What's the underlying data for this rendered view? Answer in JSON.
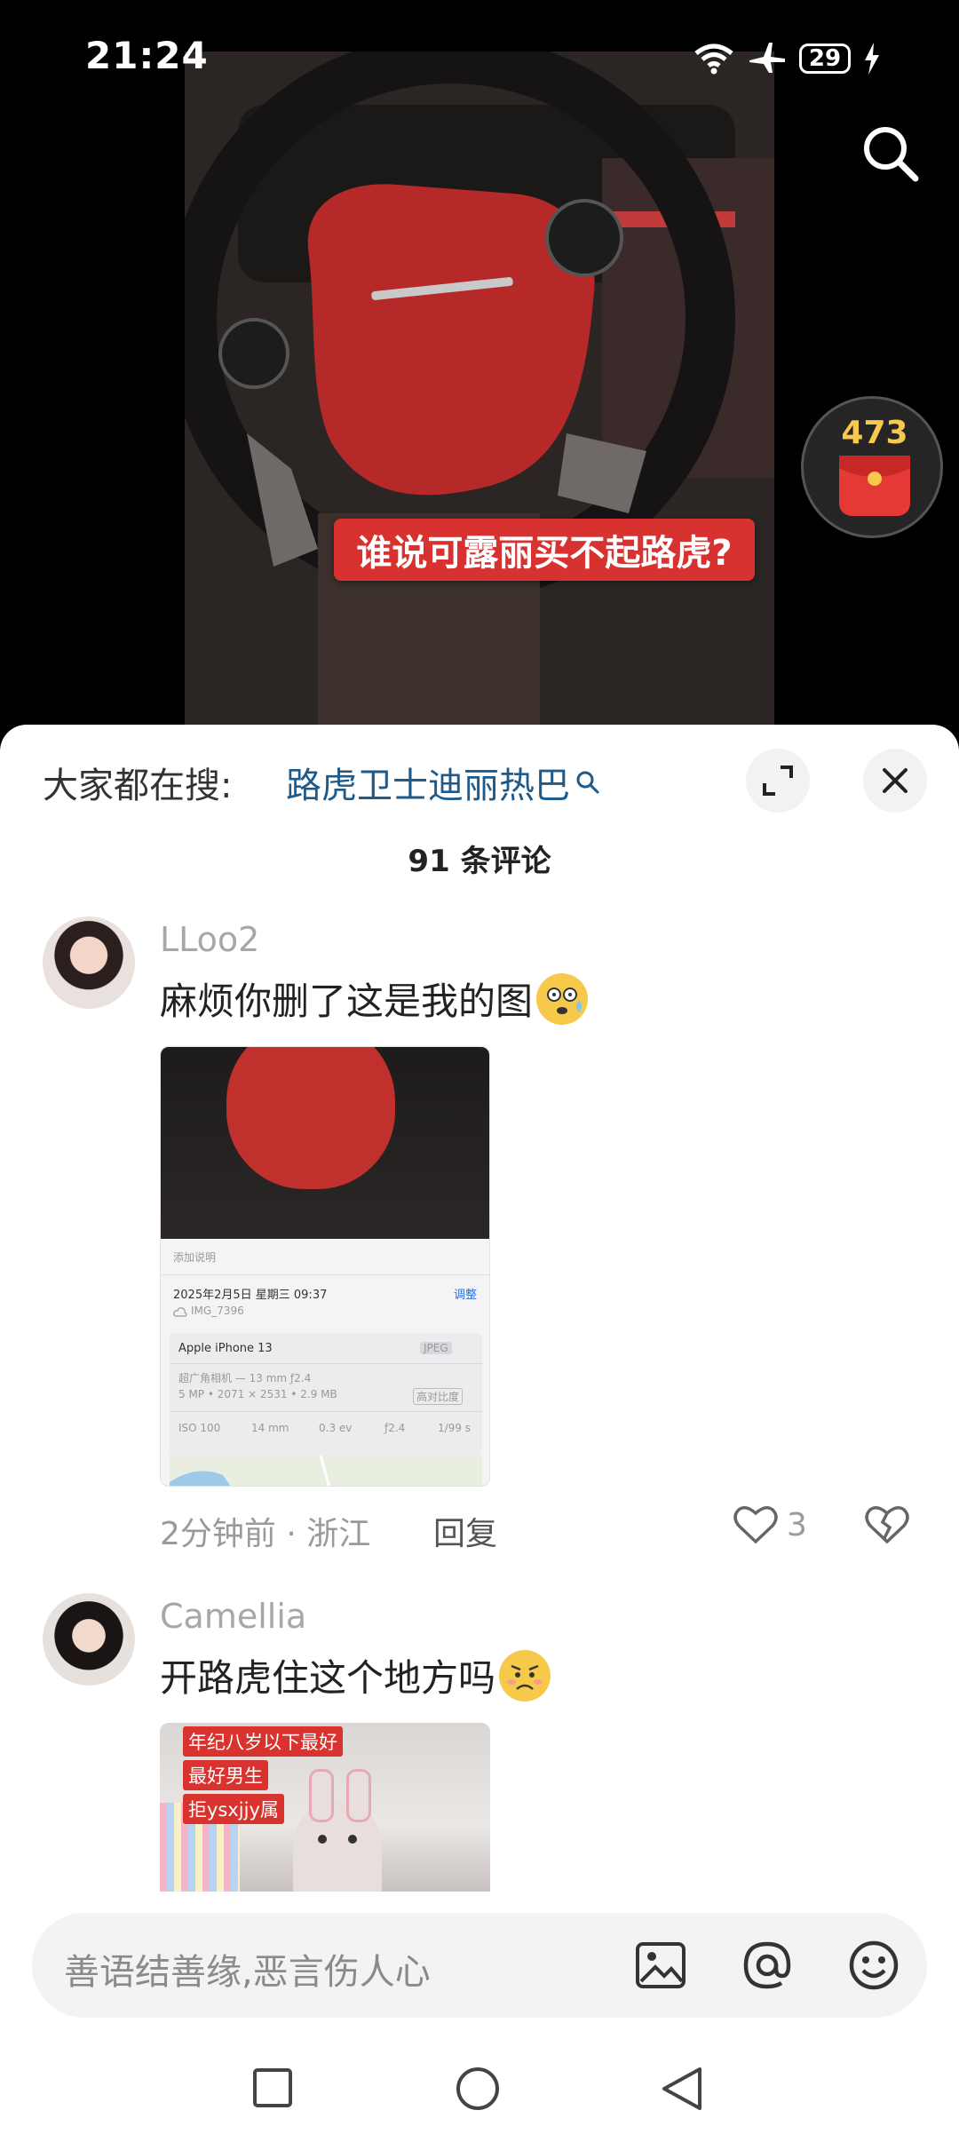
{
  "status": {
    "time": "21:24",
    "battery": "29"
  },
  "video": {
    "caption": "谁说可露丽买不起路虎?",
    "redpacket_count": "473"
  },
  "sheet": {
    "hot_search_label": "大家都在搜:",
    "hot_search_term": "路虎卫士迪丽热巴",
    "comment_count": "91 条评论"
  },
  "comments": [
    {
      "username": "LLoo2",
      "text": "麻烦你删了这是我的图",
      "time": "2分钟前",
      "location": "浙江",
      "reply": "回复",
      "likes": "3",
      "screenshot": {
        "add_caption": "添加说明",
        "date": "2025年2月5日 星期三 09:37",
        "adjust": "调整",
        "file": "IMG_7396",
        "device": "Apple iPhone 13",
        "format": "JPEG",
        "lens": "超广角相机 — 13 mm ƒ2.4",
        "specs": "5 MP • 2071 × 2531 • 2.9 MB",
        "high_ratio": "高对比度",
        "iso": "ISO 100",
        "focal": "14 mm",
        "ev": "0.3 ev",
        "aperture": "ƒ2.4",
        "shutter": "1/99 s"
      }
    },
    {
      "username": "Camellia",
      "text": "开路虎住这个地方吗",
      "image_tags": [
        "年纪八岁以下最好",
        "最好男生",
        "拒ysxjjy属"
      ]
    }
  ],
  "input": {
    "placeholder": "善语结善缘,恶言伤人心"
  },
  "colors": {
    "accent_link": "#1e5a8a",
    "caption_red": "#d7322f",
    "redpacket_gold": "#f7c94d"
  }
}
